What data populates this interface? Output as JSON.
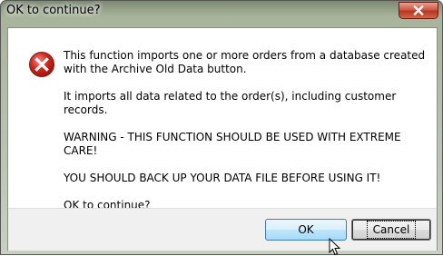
{
  "window": {
    "title": "OK to continue?",
    "close_icon": "close-icon"
  },
  "dialog": {
    "icon": "error-icon",
    "icon_color": "#d0271d",
    "paragraphs": [
      "This function imports one or more orders from a database created with the Archive Old Data button.",
      "It imports all data related to the order(s), including customer records.",
      "WARNING - THIS FUNCTION SHOULD BE USED WITH EXTREME CARE!",
      "YOU SHOULD BACK UP YOUR DATA FILE BEFORE USING IT!",
      "OK to continue?"
    ]
  },
  "buttons": {
    "ok_label": "OK",
    "cancel_label": "Cancel"
  },
  "pointer": "mouse-cursor-icon"
}
